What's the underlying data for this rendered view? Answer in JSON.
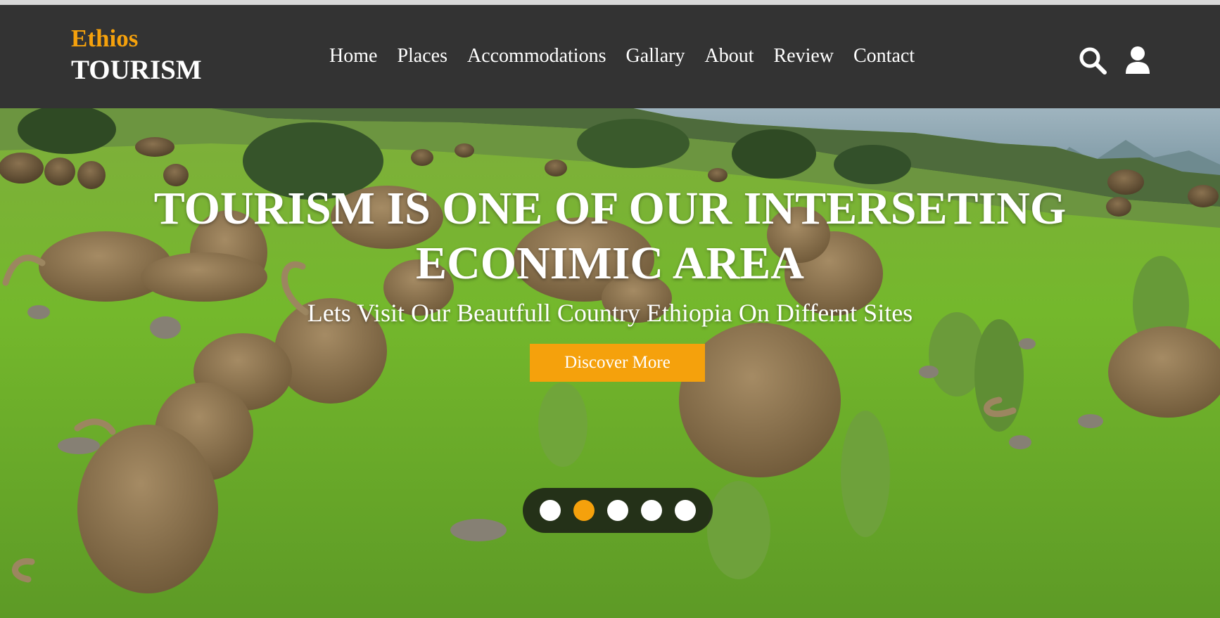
{
  "brand": {
    "line1": "Ethios",
    "line2": "TOURISM"
  },
  "nav": {
    "items": [
      {
        "label": "Home"
      },
      {
        "label": "Places"
      },
      {
        "label": "Accommodations"
      },
      {
        "label": "Gallary"
      },
      {
        "label": "About"
      },
      {
        "label": "Review"
      },
      {
        "label": "Contact"
      }
    ],
    "icons": [
      "search-icon",
      "user-icon"
    ]
  },
  "hero": {
    "title": "TOURISM IS ONE OF OUR INTERSETING ECONIMIC AREA",
    "subtitle": "Lets Visit Our Beautfull Country Ethiopia On Differnt Sites",
    "cta_label": "Discover More",
    "image": "gelada-monkeys-on-green-highland-meadow",
    "slider": {
      "count": 5,
      "active_index": 1
    }
  },
  "colors": {
    "navbar": "#333333",
    "accent": "#f5a10c",
    "text": "#ffffff"
  }
}
